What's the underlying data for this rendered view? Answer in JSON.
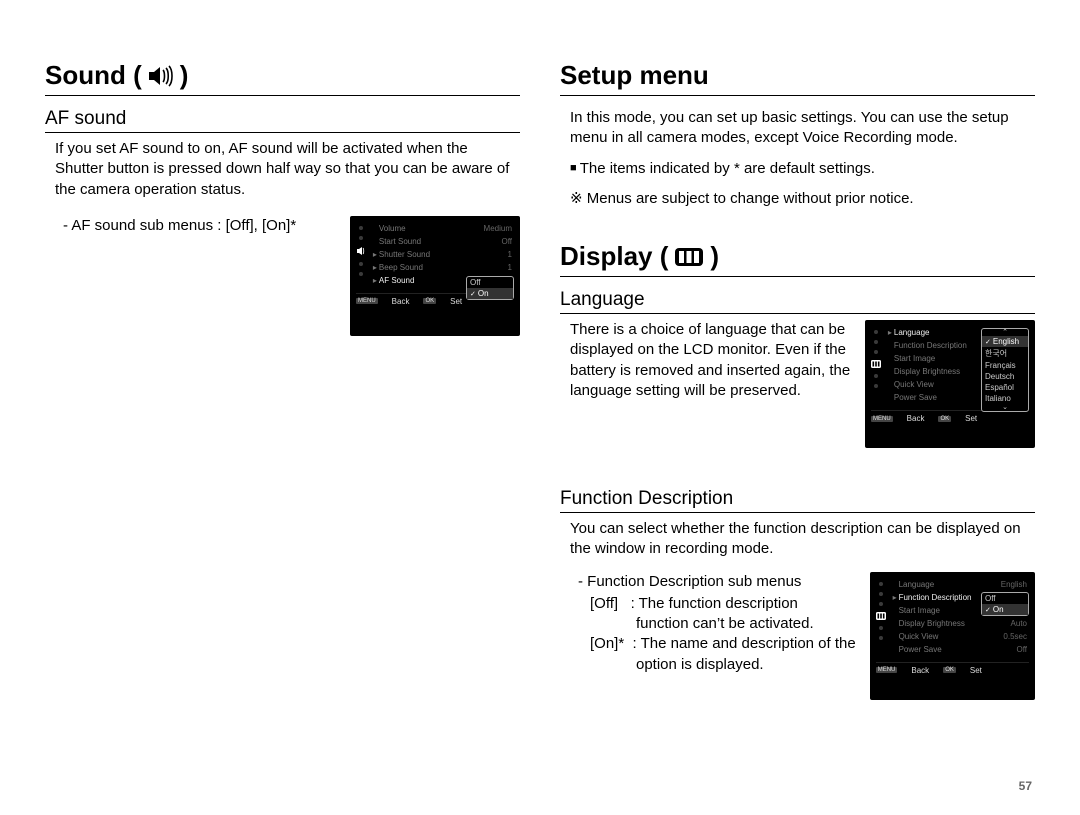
{
  "page_number": "57",
  "left": {
    "title": "Sound (",
    "title_close": ")",
    "af": {
      "heading": "AF sound",
      "para": "If you set AF sound to on, AF sound will be activated when the Shutter button is pressed down half way so that you can be aware of the camera operation status.",
      "submenu_line": "- AF sound sub menus : [Off], [On]*"
    }
  },
  "right": {
    "setup_title": "Setup menu",
    "setup_para": "In this mode, you can set up basic settings. You can use the setup menu in all camera modes, except Voice Recording mode.",
    "bullet1": "The items indicated by * are default settings.",
    "bullet2": "Menus are subject to change without prior notice.",
    "display_title_pre": "Display (",
    "display_title_post": ")",
    "lang": {
      "heading": "Language",
      "para": "There is a choice of language that can be displayed on the LCD monitor. Even if the battery is removed and inserted again, the language setting will be preserved."
    },
    "fd": {
      "heading": "Function Description",
      "para": "You can select whether the function description can be displayed on the window in recording mode.",
      "sub_intro": "- Function Description sub menus",
      "off_line_a": "[Off]   : The function description",
      "off_line_b": "function can’t be activated.",
      "on_line_a": "[On]*  : The name and description of the",
      "on_line_b": "option is displayed."
    }
  },
  "lcd_af": {
    "rows": [
      {
        "label": "Volume",
        "val": "Medium"
      },
      {
        "label": "Start Sound",
        "val": "Off"
      },
      {
        "label": "Shutter Sound",
        "val": "1"
      },
      {
        "label": "Beep Sound",
        "val": "1"
      },
      {
        "label": "AF Sound",
        "val": "On",
        "active": true
      }
    ],
    "dropdown": [
      "Off",
      "On"
    ],
    "dd_sel": 1,
    "back": "Back",
    "set": "Set",
    "menu": "MENU",
    "ok": "OK"
  },
  "lcd_lang": {
    "rows": [
      {
        "label": "Language",
        "val": "English",
        "active": true
      },
      {
        "label": "Function Description",
        "val": ""
      },
      {
        "label": "Start Image",
        "val": ""
      },
      {
        "label": "Display Brightness",
        "val": ""
      },
      {
        "label": "Quick View",
        "val": ""
      },
      {
        "label": "Power Save",
        "val": ""
      }
    ],
    "dropdown": [
      "English",
      "한국어",
      "Français",
      "Deutsch",
      "Español",
      "Italiano"
    ],
    "dd_sel": 0,
    "back": "Back",
    "set": "Set",
    "menu": "MENU",
    "ok": "OK"
  },
  "lcd_fd": {
    "rows": [
      {
        "label": "Language",
        "val": "English"
      },
      {
        "label": "Function Description",
        "val": "On",
        "active": true
      },
      {
        "label": "Start Image",
        "val": "Off"
      },
      {
        "label": "Display Brightness",
        "val": "Auto"
      },
      {
        "label": "Quick View",
        "val": "0.5sec"
      },
      {
        "label": "Power Save",
        "val": "Off"
      }
    ],
    "dropdown": [
      "Off",
      "On"
    ],
    "dd_sel": 1,
    "back": "Back",
    "set": "Set",
    "menu": "MENU",
    "ok": "OK"
  }
}
